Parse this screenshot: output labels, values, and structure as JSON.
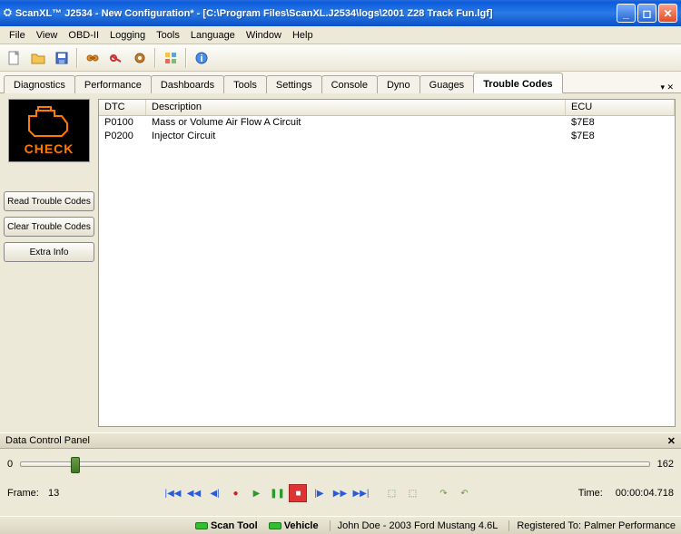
{
  "window": {
    "title": "ScanXL™ J2534 - New Configuration* - [C:\\Program Files\\ScanXL.J2534\\logs\\2001 Z28 Track Fun.lgf]"
  },
  "menu": {
    "items": [
      "File",
      "View",
      "OBD-II",
      "Logging",
      "Tools",
      "Language",
      "Window",
      "Help"
    ]
  },
  "tabs": {
    "items": [
      "Diagnostics",
      "Performance",
      "Dashboards",
      "Tools",
      "Settings",
      "Console",
      "Dyno",
      "Guages",
      "Trouble Codes"
    ],
    "active": 8
  },
  "sidebar": {
    "check_label": "CHECK",
    "btn_read": "Read Trouble Codes",
    "btn_clear": "Clear Trouble Codes",
    "btn_extra": "Extra Info"
  },
  "table": {
    "headers": {
      "dtc": "DTC",
      "desc": "Description",
      "ecu": "ECU"
    },
    "rows": [
      {
        "dtc": "P0100",
        "desc": "Mass or Volume Air Flow A Circuit",
        "ecu": "$7E8"
      },
      {
        "dtc": "P0200",
        "desc": "Injector Circuit",
        "ecu": "$7E8"
      }
    ]
  },
  "dcp": {
    "title": "Data Control Panel",
    "min": "0",
    "max": "162",
    "frame_label": "Frame:",
    "frame": "13",
    "time_label": "Time:",
    "time": "00:00:04.718"
  },
  "status": {
    "scan_tool": "Scan Tool",
    "vehicle": "Vehicle",
    "user": "John Doe - 2003 Ford Mustang 4.6L",
    "reg": "Registered To: Palmer Performance"
  }
}
